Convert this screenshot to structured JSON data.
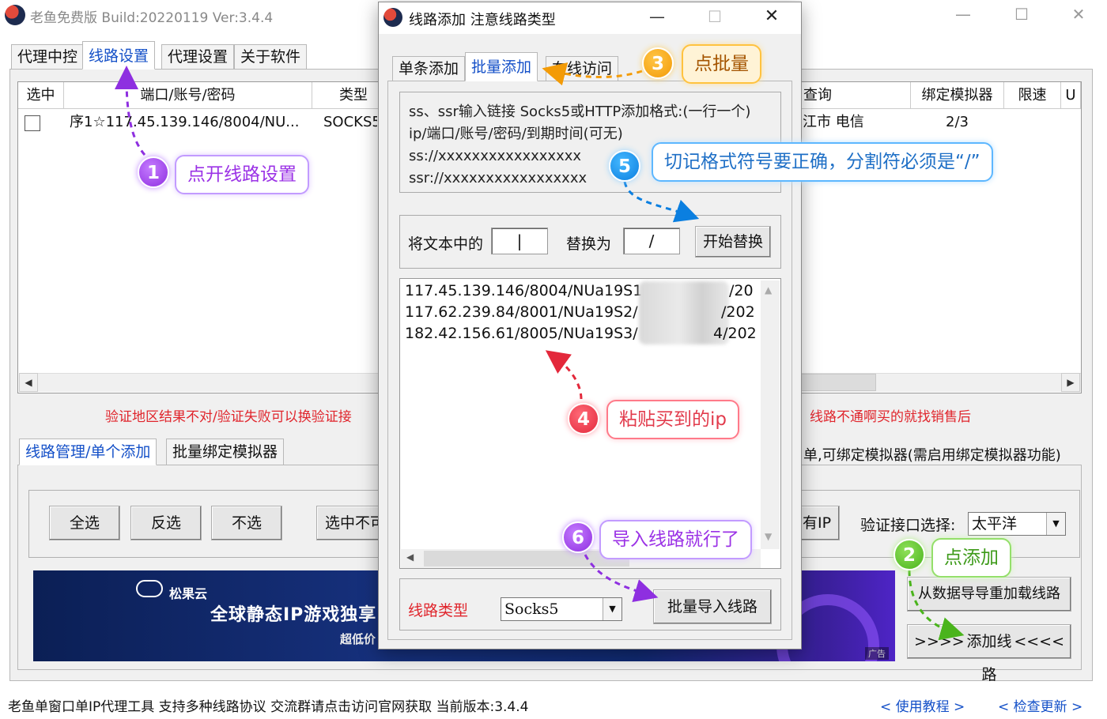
{
  "main": {
    "title": "老鱼免费版 Build:20220119 Ver:3.4.4",
    "tabs": [
      "代理中控",
      "线路设置",
      "代理设置",
      "关于软件"
    ],
    "grid": {
      "headers_left": [
        "选中",
        "端口/账号/密码",
        "类型"
      ],
      "headers_right": [
        "查询",
        "绑定模拟器",
        "限速",
        "U"
      ],
      "row": {
        "desc": "序1☆117.45.139.146/8004/NU...",
        "type": "SOCKS5",
        "query": "江市 电信",
        "bind": "2/3"
      }
    },
    "red_left": "验证地区结果不对/验证失败可以换验证接",
    "red_right": "线路不通啊买的就找销售后",
    "sub_tabs": [
      "线路管理/单个添加",
      "批量绑定模拟器"
    ],
    "sub_right_text": "单,可绑定模拟器(需启用绑定模拟器功能)",
    "buttons": {
      "select_all": "全选",
      "invert": "反选",
      "select_none": "不选",
      "selected_no": "选中不可",
      "ip_partial": "有IP",
      "reload": "从数据导导重加载线路",
      "add_line": "添加线路",
      "add_prefix": ">>>>",
      "add_suffix": "<<<<"
    },
    "verify_label": "验证接口选择:",
    "verify_value": "太平洋",
    "banner": {
      "brand": "松果云",
      "headline": "全球静态IP游戏独享",
      "sub": "超低价",
      "ad": "广告"
    },
    "status": "老鱼单窗口单IP代理工具 支持多种线路协议 交流群请点击访问官网获取  当前版本:3.4.4",
    "link_tutorial": "< 使用教程 >",
    "link_update": "< 检查更新 >"
  },
  "dialog": {
    "title": "线路添加 注意线路类型",
    "tabs": [
      "单条添加",
      "批量添加",
      "在线访问"
    ],
    "help": [
      "ss、ssr输入链接 Socks5或HTTP添加格式:(一行一个)",
      "ip/端口/账号/密码/到期时间(可无)",
      "ss://xxxxxxxxxxxxxxxxx",
      "ssr://xxxxxxxxxxxxxxxxx"
    ],
    "replace_label": "将文本中的",
    "replace_from": "|",
    "replace_with_label": "替换为",
    "replace_to": "/",
    "start_replace": "开始替换",
    "lines": [
      "117.45.139.146/8004/NUa19S1/",
      "117.62.239.84/8001/NUa19S2/",
      "182.42.156.61/8005/NUa19S3/"
    ],
    "line_tails": [
      "/20",
      "/202",
      "4/202"
    ],
    "type_label": "线路类型",
    "type_value": "Socks5",
    "import_button": "批量导入线路"
  },
  "annotations": {
    "n1": "1",
    "t1": "点开线路设置",
    "n2": "2",
    "t2": "点添加",
    "n3": "3",
    "t3": "点批量",
    "n4": "4",
    "t4": "粘贴买到的ip",
    "n5": "5",
    "t5": "切记格式符号要正确，分割符必须是“/”",
    "n6": "6",
    "t6": "导入线路就行了"
  },
  "colors": {
    "accent": "#1450c8",
    "warning": "#e0252c"
  }
}
